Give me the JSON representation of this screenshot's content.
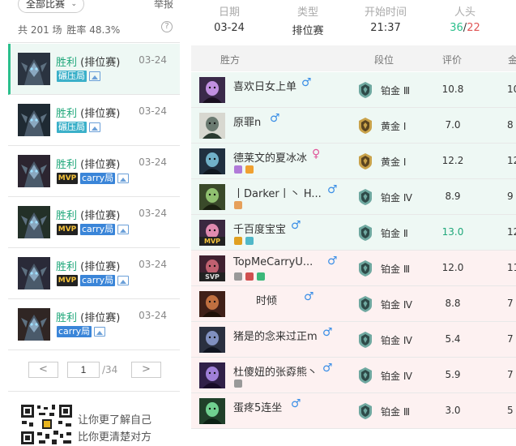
{
  "left": {
    "filter": {
      "label": "全部比赛",
      "caret_icon": "chevron-down-icon"
    },
    "report_label": "举报",
    "stats": {
      "total": "共 201 场",
      "winrate": "胜率 48.3%"
    },
    "help_label": "?",
    "matches": [
      {
        "result": "胜利",
        "mode": "(排位赛)",
        "date": "03-24",
        "tag": "碾压局",
        "tag_color": "#3bb0c9",
        "mvp": "",
        "active": true
      },
      {
        "result": "胜利",
        "mode": "(排位赛)",
        "date": "03-24",
        "tag": "碾压局",
        "tag_color": "#3bb0c9",
        "mvp": "",
        "active": false
      },
      {
        "result": "胜利",
        "mode": "(排位赛)",
        "date": "03-24",
        "tag": "carry局",
        "tag_color": "#3a85d8",
        "mvp": "MVP",
        "active": false
      },
      {
        "result": "胜利",
        "mode": "(排位赛)",
        "date": "03-24",
        "tag": "carry局",
        "tag_color": "#3a85d8",
        "mvp": "MVP",
        "active": false
      },
      {
        "result": "胜利",
        "mode": "(排位赛)",
        "date": "03-24",
        "tag": "carry局",
        "tag_color": "#3a85d8",
        "mvp": "MVP",
        "active": false
      },
      {
        "result": "胜利",
        "mode": "(排位赛)",
        "date": "03-24",
        "tag": "carry局",
        "tag_color": "#3a85d8",
        "mvp": "",
        "active": false
      }
    ],
    "pagination": {
      "prev": "<",
      "next": ">",
      "current": "1",
      "total": "/34"
    },
    "promo": {
      "line1": "让你更了解自己",
      "line2": "比你更清楚对方"
    }
  },
  "summary": {
    "date_label": "日期",
    "date": "03-24",
    "type_label": "类型",
    "type": "排位赛",
    "time_label": "开始时间",
    "time": "21:37",
    "kills_label": "人头",
    "kills": "36",
    "slash": "/",
    "deaths": "22"
  },
  "table": {
    "headers": {
      "side": "胜方",
      "tier": "段位",
      "score": "评价",
      "gold": "金"
    },
    "rows": [
      {
        "name": "喜欢日女上单",
        "gender": "♂",
        "gender_color": "#3a8ee6",
        "badge": "",
        "tier": "铂金 Ⅲ",
        "rank": "platinum",
        "score": "10.8",
        "gold": "10",
        "bg": "#eef8f4",
        "icons": []
      },
      {
        "name": "原罪n",
        "gender": "♂",
        "gender_color": "#3a8ee6",
        "badge": "",
        "tier": "黄金 Ⅰ",
        "rank": "gold",
        "score": "7.0",
        "gold": "8",
        "bg": "#eef8f4",
        "icons": []
      },
      {
        "name": "德莱文的夏冰冰",
        "gender": "♀",
        "gender_color": "#e0559a",
        "badge": "",
        "tier": "黄金 Ⅰ",
        "rank": "gold",
        "score": "12.2",
        "gold": "12",
        "bg": "#eef8f4",
        "icons": [
          "#b07ad8",
          "#f0a030"
        ]
      },
      {
        "name": "丨Darker丨丶 H...",
        "gender": "♂",
        "gender_color": "#3a8ee6",
        "badge": "",
        "tier": "铂金 Ⅳ",
        "rank": "platinum",
        "score": "8.9",
        "gold": "9",
        "bg": "#eef8f4",
        "icons": [
          "#e6a05a"
        ]
      },
      {
        "name": "千百度宝宝",
        "gender": "♂",
        "gender_color": "#3a8ee6",
        "badge": "MVP",
        "tier": "铂金 Ⅱ",
        "rank": "platinum",
        "score": "13.0",
        "gold": "12",
        "bg": "#eef8f4",
        "icons": [
          "#e0a020",
          "#50b8c8"
        ],
        "highlight": true
      },
      {
        "name": "TopMeCarryU...",
        "gender": "♂",
        "gender_color": "#3a8ee6",
        "badge": "SVP",
        "tier": "铂金 Ⅲ",
        "rank": "platinum",
        "score": "12.0",
        "gold": "11",
        "bg": "#fdf1f1",
        "icons": [
          "#999999",
          "#d05050",
          "#3cb87a"
        ]
      },
      {
        "name": "时倾",
        "gender": "♂",
        "gender_color": "#3a8ee6",
        "badge": "",
        "tier": "铂金 Ⅳ",
        "rank": "platinum",
        "score": "8.8",
        "gold": "7",
        "bg": "#fdf1f1",
        "icons": [],
        "indent": true
      },
      {
        "name": "猪是的念来过正m",
        "gender": "♂",
        "gender_color": "#3a8ee6",
        "badge": "",
        "tier": "铂金 Ⅳ",
        "rank": "platinum",
        "score": "5.4",
        "gold": "7",
        "bg": "#fdf1f1",
        "icons": []
      },
      {
        "name": "杜傻妞的张孬熊丶",
        "gender": "♂",
        "gender_color": "#3a8ee6",
        "badge": "",
        "tier": "铂金 Ⅳ",
        "rank": "platinum",
        "score": "5.9",
        "gold": "7",
        "bg": "#fdf1f1",
        "icons": [
          "#999999"
        ]
      },
      {
        "name": "蛋疼5连坐",
        "gender": "♂",
        "gender_color": "#3a8ee6",
        "badge": "",
        "tier": "铂金 Ⅲ",
        "rank": "platinum",
        "score": "3.0",
        "gold": "5",
        "bg": "#fdf1f1",
        "icons": []
      }
    ]
  }
}
